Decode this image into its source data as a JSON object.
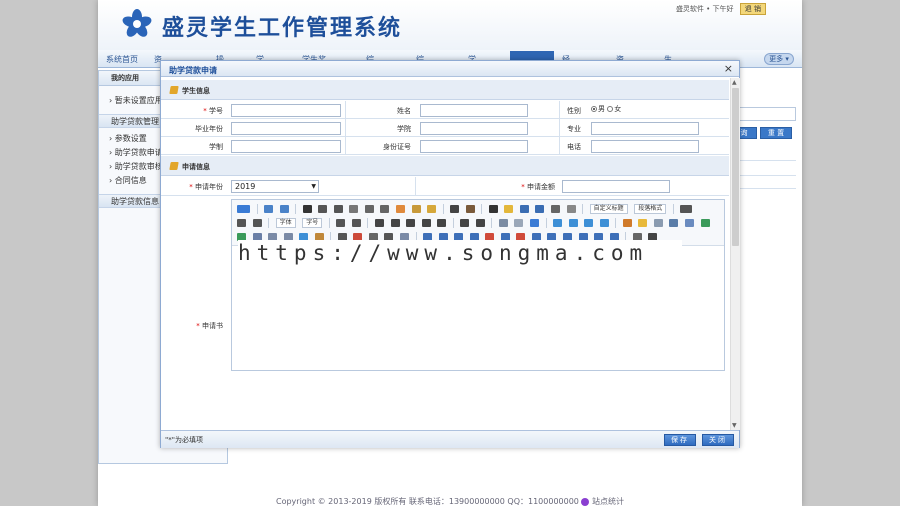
{
  "app": {
    "title": "盛灵学生工作管理系统",
    "top_right_text": "盛灵软件 • 下午好",
    "exit_label": "退 销"
  },
  "nav": {
    "items": [
      "系统首页",
      "资",
      "操",
      "学",
      "学生奖",
      "综",
      "综",
      "学",
      "经",
      "资",
      "生"
    ],
    "more_label": "更多"
  },
  "sidebar": {
    "title": "我的应用",
    "items": [
      "暂未设置应用"
    ],
    "group_title": "助学贷款管理",
    "sub_items": [
      "参数设置",
      "助学贷款申请",
      "助学贷款审核",
      "合同信息"
    ],
    "group2_title": "助学贷款信息"
  },
  "background_page": {
    "search_btn": "询",
    "reset_btn": "重 置"
  },
  "footer": {
    "copyright": "Copyright ©    2013-2019 版权所有  联系电话：13900000000  QQ：1100000000",
    "stats": "站点统计"
  },
  "dialog": {
    "title": "助学贷款申请",
    "close_glyph": "×",
    "student_section": {
      "title": "学生信息",
      "labels": {
        "student_no": "学号",
        "name": "姓名",
        "gender": "性别",
        "grad_year": "毕业年份",
        "college": "学院",
        "major": "专业",
        "study_length": "学制",
        "id_card": "身份证号",
        "phone": "电话"
      },
      "gender_options": [
        "男",
        "女"
      ],
      "gender_selected": "男"
    },
    "apply_section": {
      "title": "申请信息",
      "labels": {
        "apply_year": "申请年份",
        "amount": "申请金额",
        "letter": "申请书"
      },
      "apply_year_value": "2019"
    },
    "editor": {
      "custom_title_select": "自定义标题",
      "paragraph_select": "段落格式",
      "font_select": "字体",
      "size_select": "字号",
      "watermark": "https://www.songma.com"
    },
    "footer": {
      "note": "\"*\"为必填项",
      "save_label": "保存",
      "close_label": "关闭"
    }
  },
  "colors": {
    "brand": "#1e4f9a",
    "required": "#dd0000",
    "button": "#2f6bbf"
  }
}
